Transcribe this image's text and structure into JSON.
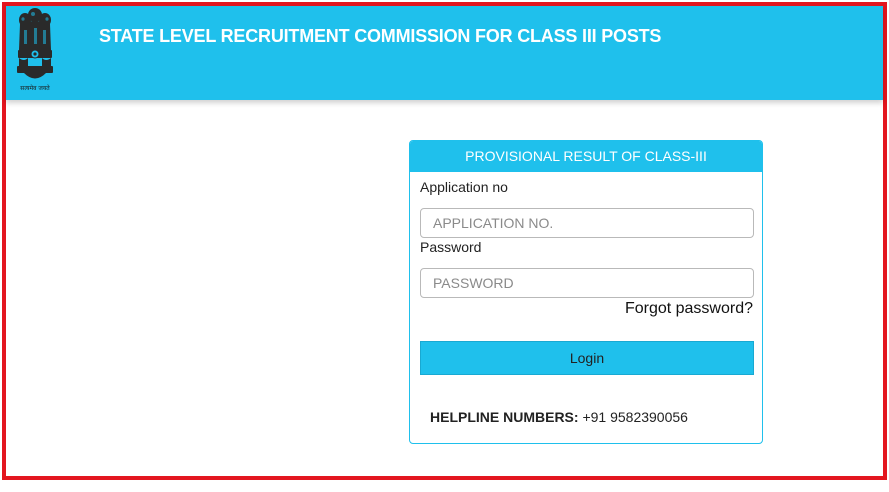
{
  "header": {
    "title": "STATE LEVEL RECRUITMENT COMMISSION FOR CLASS III POSTS",
    "emblem_caption": "सत्यमेव जयते"
  },
  "login_card": {
    "heading": "PROVISIONAL RESULT OF CLASS-III",
    "application_label": "Application no",
    "application_placeholder": "APPLICATION NO.",
    "application_value": "",
    "password_label": "Password",
    "password_placeholder": "PASSWORD",
    "password_value": "",
    "forgot_link": "Forgot password?",
    "login_button": "Login",
    "helpline_label": "HELPLINE NUMBERS:",
    "helpline_number": "+91 9582390056"
  },
  "colors": {
    "header_bg": "#1fc0ec",
    "frame_border": "#e3161f",
    "button_bg": "#1fc0ec"
  }
}
